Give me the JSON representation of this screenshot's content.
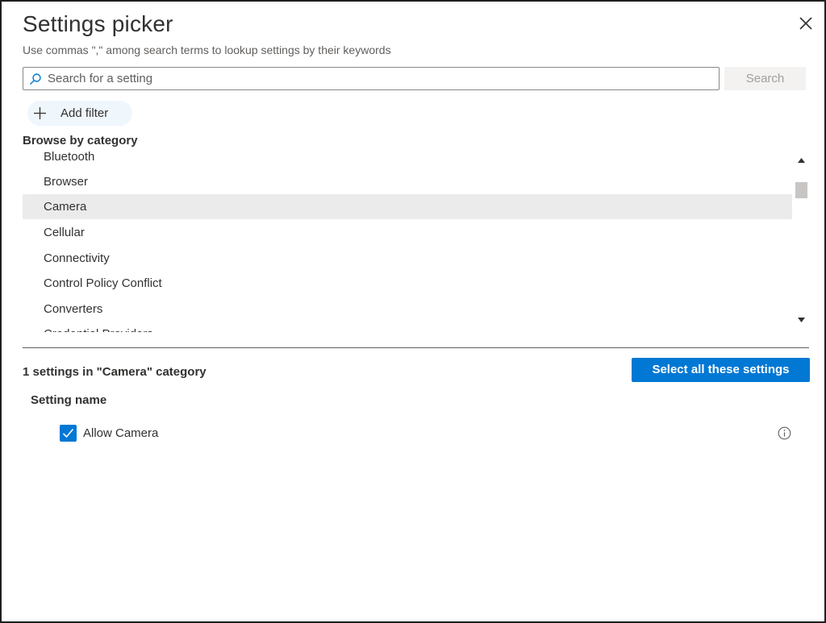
{
  "dialog": {
    "title": "Settings picker",
    "subtitle": "Use commas \",\" among search terms to lookup settings by their keywords"
  },
  "search": {
    "placeholder": "Search for a setting",
    "value": "",
    "button_label": "Search"
  },
  "filter": {
    "add_label": "Add filter"
  },
  "browse": {
    "label": "Browse by category",
    "categories": [
      {
        "label": "Bluetooth"
      },
      {
        "label": "Browser"
      },
      {
        "label": "Camera",
        "selected": true
      },
      {
        "label": "Cellular"
      },
      {
        "label": "Connectivity"
      },
      {
        "label": "Control Policy Conflict"
      },
      {
        "label": "Converters"
      },
      {
        "label": "Credential Providers"
      }
    ]
  },
  "results": {
    "count_label": "1 settings in \"Camera\" category",
    "select_all_label": "Select all these settings",
    "column_header": "Setting name",
    "settings": [
      {
        "label": "Allow Camera",
        "checked": true
      }
    ]
  },
  "colors": {
    "accent": "#0078d4",
    "selected_row": "#ebebeb",
    "filter_pill": "#eff6fc"
  },
  "icons": {
    "close": "close-icon",
    "search": "search-icon",
    "add": "plus-icon",
    "info": "info-icon",
    "check": "checkmark-icon"
  }
}
